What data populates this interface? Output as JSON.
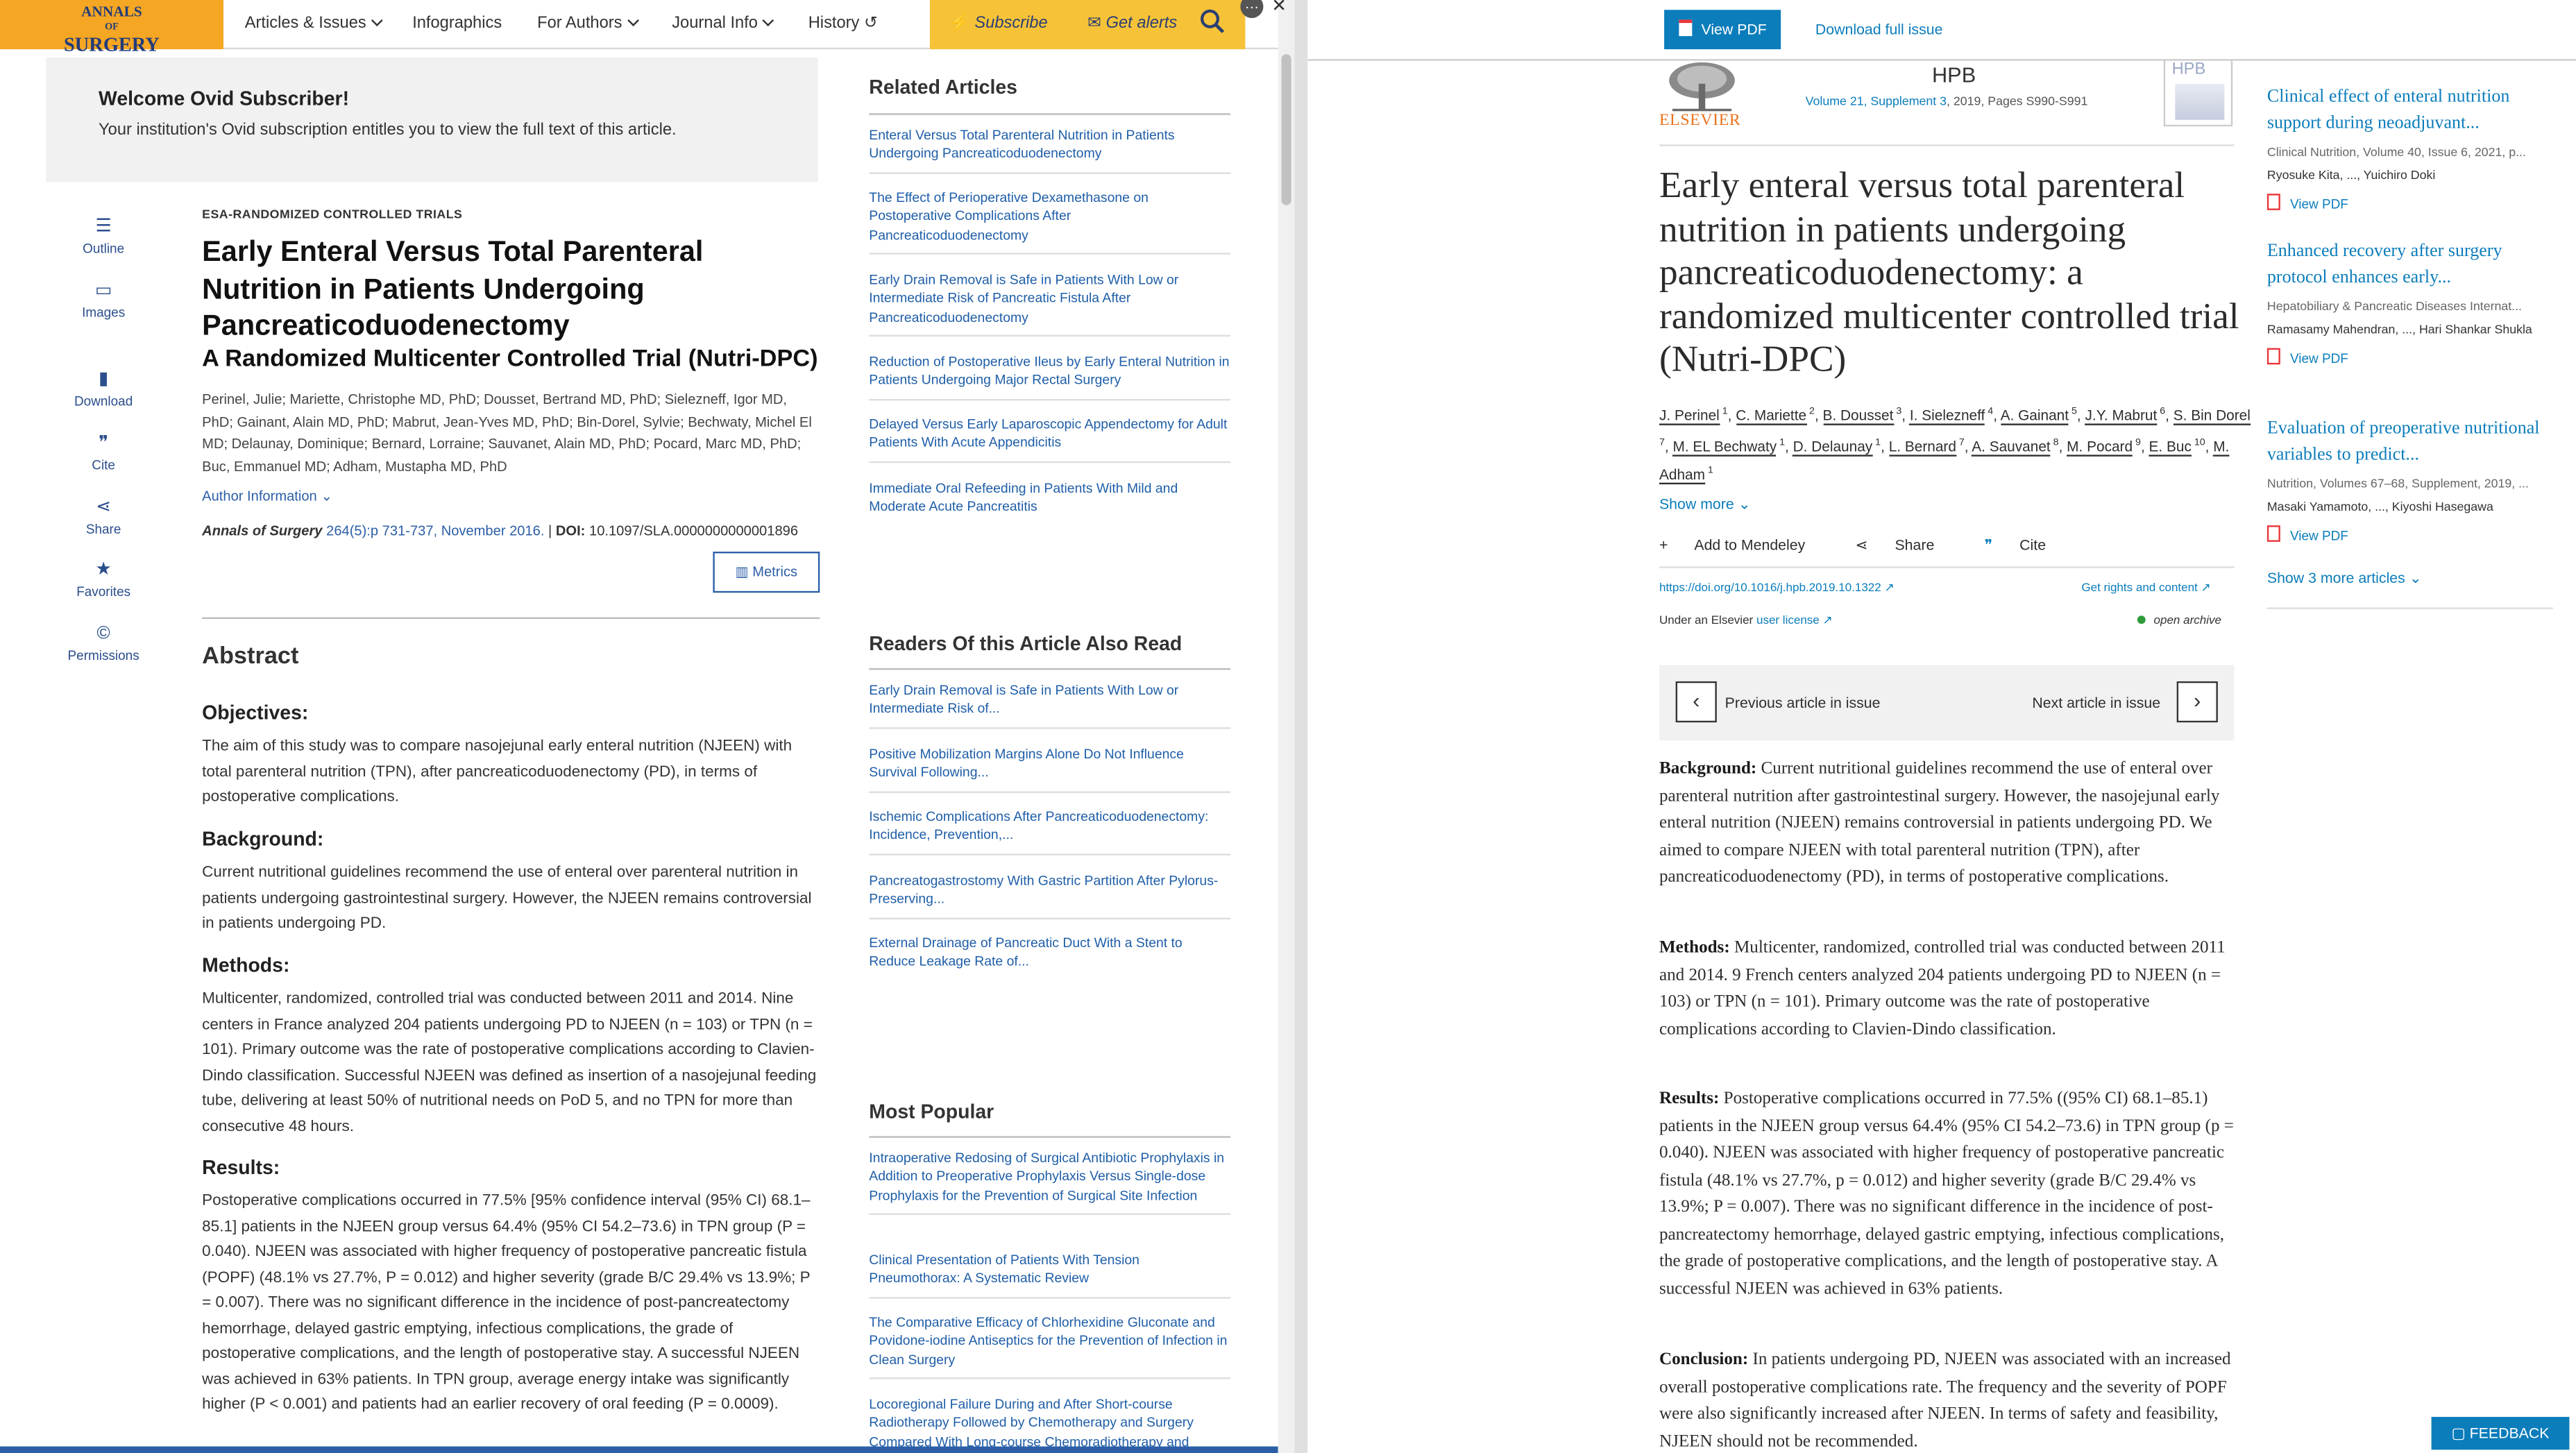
{
  "left": {
    "logo": {
      "line1": "ANNALS",
      "line2": "OF",
      "line3": "SURGERY"
    },
    "nav": {
      "articles": "Articles & Issues",
      "infographics": "Infographics",
      "for_authors": "For Authors",
      "journal_info": "Journal Info",
      "history": "History",
      "subscribe": "Subscribe",
      "get_alerts": "Get alerts"
    },
    "welcome": {
      "title": "Welcome Ovid Subscriber!",
      "text": "Your institution's Ovid subscription entitles you to view the full text of this article."
    },
    "tools": {
      "outline": "Outline",
      "images": "Images",
      "download": "Download",
      "cite": "Cite",
      "share": "Share",
      "favorites": "Favorites",
      "permissions": "Permissions"
    },
    "article": {
      "kicker": "ESA-RANDOMIZED CONTROLLED TRIALS",
      "title": "Early Enteral Versus Total Parenteral Nutrition in Patients Undergoing Pancreaticoduodenectomy",
      "subtitle": "A Randomized Multicenter Controlled Trial (Nutri-DPC)",
      "authors": "Perinel, Julie; Mariette, Christophe MD, PhD; Dousset, Bertrand MD, PhD; Sielezneff, Igor MD, PhD; Gainant, Alain MD, PhD; Mabrut, Jean-Yves MD, PhD; Bin-Dorel, Sylvie; Bechwaty, Michel El MD; Delaunay, Dominique; Bernard, Lorraine; Sauvanet, Alain MD, PhD; Pocard, Marc MD, PhD; Buc, Emmanuel MD; Adham, Mustapha MD, PhD",
      "author_info": "Author Information",
      "journal": "Annals of Surgery",
      "volume": "264(5):p 731-737, November 2016.",
      "doi_label": "DOI:",
      "doi": "10.1097/SLA.0000000000001896",
      "metrics": "Metrics"
    },
    "abstract": {
      "heading": "Abstract",
      "objectives_h": "Objectives:",
      "objectives": "The aim of this study was to compare nasojejunal early enteral nutrition (NJEEN) with total parenteral nutrition (TPN), after pancreaticoduodenectomy (PD), in terms of postoperative complications.",
      "background_h": "Background:",
      "background": "Current nutritional guidelines recommend the use of enteral over parenteral nutrition in patients undergoing gastrointestinal surgery. However, the NJEEN remains controversial in patients undergoing PD.",
      "methods_h": "Methods:",
      "methods": "Multicenter, randomized, controlled trial was conducted between 2011 and 2014. Nine centers in France analyzed 204 patients undergoing PD to NJEEN (n = 103) or TPN (n = 101). Primary outcome was the rate of postoperative complications according to Clavien-Dindo classification. Successful NJEEN was defined as insertion of a nasojejunal feeding tube, delivering at least 50% of nutritional needs on PoD 5, and no TPN for more than consecutive 48 hours.",
      "results_h": "Results:",
      "results": "Postoperative complications occurred in 77.5% [95% confidence interval (95% CI) 68.1–85.1] patients in the NJEEN group versus 64.4% (95% CI 54.2–73.6) in TPN group (P = 0.040). NJEEN was associated with higher frequency of postoperative pancreatic fistula (POPF) (48.1% vs 27.7%, P = 0.012) and higher severity (grade B/C 29.4% vs 13.9%; P = 0.007). There was no significant difference in the incidence of post-pancreatectomy hemorrhage, delayed gastric emptying, infectious complications, the grade of postoperative complications, and the length of postoperative stay. A successful NJEEN was achieved in 63% patients. In TPN group, average energy intake was significantly higher (P < 0.001) and patients had an earlier recovery of oral feeding (P = 0.0009)."
    },
    "related": {
      "heading": "Related Articles",
      "items": [
        "Enteral Versus Total Parenteral Nutrition in Patients Undergoing Pancreaticoduodenectomy",
        "The Effect of Perioperative Dexamethasone on Postoperative Complications After Pancreaticoduodenectomy",
        "Early Drain Removal is Safe in Patients With Low or Intermediate Risk of Pancreatic Fistula After Pancreaticoduodenectomy",
        "Reduction of Postoperative Ileus by Early Enteral Nutrition in Patients Undergoing Major Rectal Surgery",
        "Delayed Versus Early Laparoscopic Appendectomy for Adult Patients With Acute Appendicitis",
        "Immediate Oral Refeeding in Patients With Mild and Moderate Acute Pancreatitis"
      ]
    },
    "readers": {
      "heading": "Readers Of this Article Also Read",
      "items": [
        "Early Drain Removal is Safe in Patients With Low or Intermediate Risk of...",
        "Positive Mobilization Margins Alone Do Not Influence Survival Following...",
        "Ischemic Complications After Pancreaticoduodenectomy: Incidence, Prevention,...",
        "Pancreatogastrostomy With Gastric Partition After Pylorus-Preserving...",
        "External Drainage of Pancreatic Duct With a Stent to Reduce Leakage Rate of..."
      ]
    },
    "popular": {
      "heading": "Most Popular",
      "items": [
        "Intraoperative Redosing of Surgical Antibiotic Prophylaxis in Addition to Preoperative Prophylaxis Versus Single-dose Prophylaxis for the Prevention of Surgical Site Infection",
        "Clinical Presentation of Patients With Tension Pneumothorax: A Systematic Review",
        "The Comparative Efficacy of Chlorhexidine Gluconate and Povidone-iodine Antiseptics for the Prevention of Infection in Clean Surgery",
        "Locoregional Failure During and After Short-course Radiotherapy Followed by Chemotherapy and Surgery Compared With Long-course Chemoradiotherapy and"
      ]
    }
  },
  "right": {
    "toolbar": {
      "view_pdf": "View PDF",
      "download_full": "Download full issue"
    },
    "journal": {
      "publisher": "ELSEVIER",
      "name": "HPB",
      "volume_link": "Volume 21, Supplement 3",
      "volume_rest": ", 2019, Pages S990-S991",
      "cover_text": "HPB"
    },
    "title": "Early enteral versus total parenteral nutrition in patients undergoing pancreaticoduodenectomy: a randomized multicenter controlled trial (Nutri-DPC)",
    "authors": [
      {
        "name": "J. Perinel",
        "sup": "1"
      },
      {
        "name": "C. Mariette",
        "sup": "2"
      },
      {
        "name": "B. Dousset",
        "sup": "3"
      },
      {
        "name": "I. Sielezneff",
        "sup": "4"
      },
      {
        "name": "A. Gainant",
        "sup": "5"
      },
      {
        "name": "J.Y. Mabrut",
        "sup": "6"
      },
      {
        "name": "S. Bin Dorel",
        "sup": "7"
      },
      {
        "name": "M. EL Bechwaty",
        "sup": "1"
      },
      {
        "name": "D. Delaunay",
        "sup": "1"
      },
      {
        "name": "L. Bernard",
        "sup": "7"
      },
      {
        "name": "A. Sauvanet",
        "sup": "8"
      },
      {
        "name": "M. Pocard",
        "sup": "9"
      },
      {
        "name": "E. Buc",
        "sup": "10"
      },
      {
        "name": "M. Adham",
        "sup": "1"
      }
    ],
    "show_more": "Show more",
    "actions": {
      "mendeley": "Add to Mendeley",
      "share": "Share",
      "cite": "Cite"
    },
    "doi": "https://doi.org/10.1016/j.hpb.2019.10.1322",
    "rights": "Get rights and content",
    "license_prefix": "Under an Elsevier",
    "license_link": "user license",
    "open_archive": "open archive",
    "prev": "Previous article in issue",
    "next": "Next article in issue",
    "abstract": {
      "background_h": "Background:",
      "background": "Current nutritional guidelines recommend the use of enteral over parenteral nutrition after gastrointestinal surgery. However, the nasojejunal early enteral nutrition (NJEEN) remains controversial in patients undergoing PD. We aimed to compare NJEEN with total parenteral nutrition (TPN), after pancreaticoduodenectomy (PD), in terms of postoperative complications.",
      "methods_h": "Methods:",
      "methods": "Multicenter, randomized, controlled trial was conducted between 2011 and 2014. 9 French centers analyzed 204 patients undergoing PD to NJEEN (n = 103) or TPN (n = 101). Primary outcome was the rate of postoperative complications according to Clavien-Dindo classification.",
      "results_h": "Results:",
      "results": "Postoperative complications occurred in 77.5% ((95% CI) 68.1–85.1) patients in the NJEEN group versus 64.4% (95% CI 54.2–73.6) in TPN group (p = 0.040). NJEEN was associated with higher frequency of postoperative pancreatic fistula (48.1% vs 27.7%, p = 0.012) and higher severity (grade B/C 29.4% vs 13.9%; P = 0.007). There was no significant difference in the incidence of post-pancreatectomy hemorrhage, delayed gastric emptying, infectious complications, the grade of postoperative complications, and the length of postoperative stay. A successful NJEEN was achieved in 63% patients.",
      "conclusion_h": "Conclusion:",
      "conclusion": "In patients undergoing PD, NJEEN was associated with an increased overall postoperative complications rate. The frequency and the severity of POPF were also significantly increased after NJEEN. In terms of safety and feasibility, NJEEN should not be recommended."
    },
    "side_articles": [
      {
        "title": "Clinical effect of enteral nutrition support during neoadjuvant...",
        "meta": "Clinical Nutrition, Volume 40, Issue 6, 2021, p...",
        "authors": "Ryosuke Kita, ..., Yuichiro Doki",
        "pdf": "View PDF"
      },
      {
        "title": "Enhanced recovery after surgery protocol enhances early...",
        "meta": "Hepatobiliary & Pancreatic Diseases Internat...",
        "authors": "Ramasamy Mahendran, ..., Hari Shankar Shukla",
        "pdf": "View PDF"
      },
      {
        "title": "Evaluation of preoperative nutritional variables to predict...",
        "meta": "Nutrition, Volumes 67–68, Supplement, 2019, ...",
        "authors": "Masaki Yamamoto, ..., Kiyoshi Hasegawa",
        "pdf": "View PDF"
      }
    ],
    "show_3_more": "Show 3 more articles",
    "feedback": "FEEDBACK"
  },
  "colors": {
    "brand_orange": "#f5a623",
    "alert_yellow": "#f6c338",
    "ovid_link": "#1f5ea8",
    "elsevier_blue": "#0c7dbb",
    "elsevier_orange": "#e9711c"
  }
}
